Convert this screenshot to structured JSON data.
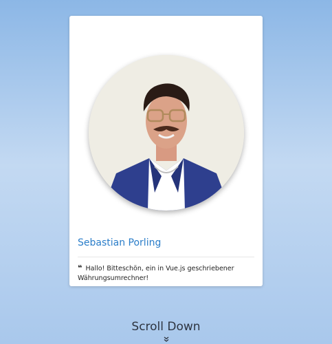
{
  "profile": {
    "name": "Sebastian Porling",
    "photo_alt": "profile-photo",
    "quote_icon": "quote-left-icon",
    "quote_glyph": "❝",
    "quote_text": "Hallo! Bitteschön, ein in Vue.js geschriebener Währungsumrechner!"
  },
  "footer": {
    "scroll_label": "Scroll Down",
    "scroll_icon": "double-chevron-down-icon",
    "scroll_glyph": "⌄"
  },
  "colors": {
    "accent": "#2a7dc9",
    "background_top": "#8cb7e6",
    "background_bottom": "#a9c8ec"
  }
}
